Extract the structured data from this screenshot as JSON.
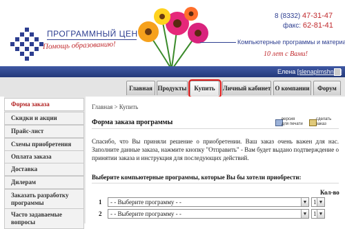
{
  "header": {
    "logo_title": "ПРОГРАММНЫЙ ЦЕНТР",
    "logo_slogan": "Помощь образованию!",
    "phone_prefix": "8 (8332)",
    "phone_number": "47-31-47",
    "fax_prefix": "факс:",
    "fax_number": "62-81-41",
    "subtitle": "Компьютерные программы и материалы",
    "anniversary": "10 лет с Вами!",
    "brand_color": "#2d3e90",
    "accent_color": "#c0282c"
  },
  "user_bar": {
    "name": "Елена",
    "login": "[slenaplmshnva]",
    "logout_icon": "logout-icon"
  },
  "tabs": [
    {
      "label": "Главная"
    },
    {
      "label": "Продукты"
    },
    {
      "label": "Купить"
    },
    {
      "label": "Личный кабинет"
    },
    {
      "label": "О компании"
    },
    {
      "label": "Форум"
    }
  ],
  "sidebar": {
    "items": [
      {
        "label": "Форма заказа",
        "active": true
      },
      {
        "label": "Скидки и акции"
      },
      {
        "label": "Прайс-лист"
      },
      {
        "label": "Схемы приобретения"
      },
      {
        "label": "Оплата заказа"
      },
      {
        "label": "Доставка"
      },
      {
        "label": "Дилерам"
      },
      {
        "label": "Заказать разработку программы"
      },
      {
        "label": "Часто задаваемые вопросы"
      }
    ]
  },
  "main": {
    "breadcrumb": "Главная > Купить",
    "print_link_line1": "версия",
    "print_link_line2": "для печати",
    "order_link_line1": "сделать",
    "order_link_line2": "заказ",
    "title": "Форма заказа программы",
    "intro": "Спасибо, что Вы приняли решение о приобретении. Ваш заказ очень важен для нас. Заполните данные заказа, нажмите кнопку \"Отправить\" - Вам будет выдано подтверждение о принятии заказа и инструкция для последующих действий.",
    "select_title": "Выберите компьютерные программы, которые Вы бы хотели приобрести:",
    "qty_header": "Кол-во",
    "rows": [
      {
        "num": "1",
        "program": "- - Выберите программу - -",
        "qty": "1"
      },
      {
        "num": "2",
        "program": "- - Выберите программу - -",
        "qty": "1"
      }
    ]
  }
}
